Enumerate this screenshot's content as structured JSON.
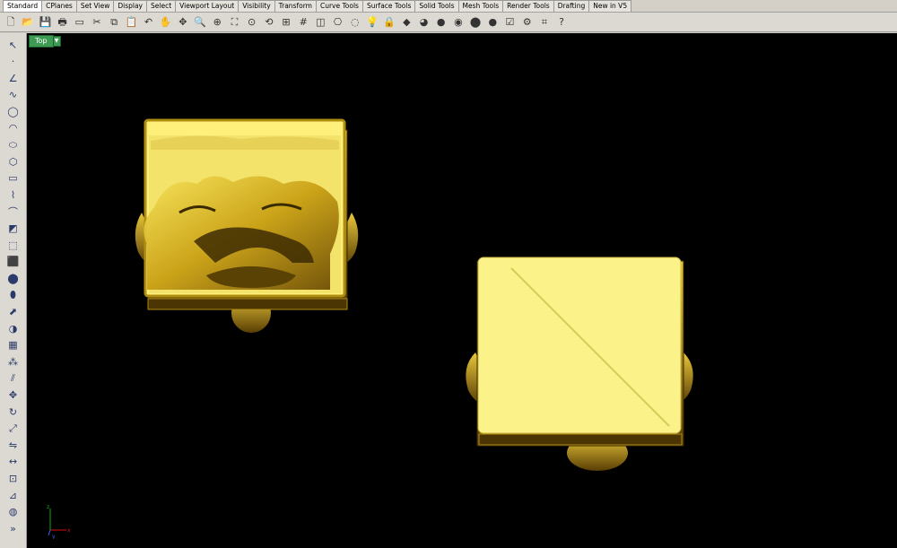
{
  "tabs": [
    "Standard",
    "CPlanes",
    "Set View",
    "Display",
    "Select",
    "Viewport Layout",
    "Visibility",
    "Transform",
    "Curve Tools",
    "Surface Tools",
    "Solid Tools",
    "Mesh Tools",
    "Render Tools",
    "Drafting",
    "New in V5"
  ],
  "toolbar_icons": [
    "new-file-icon",
    "open-icon",
    "save-icon",
    "print-icon",
    "import-icon",
    "cut-icon",
    "copy-icon",
    "paste-icon",
    "undo-icon",
    "pan-icon",
    "move-view-icon",
    "zoom-icon",
    "zoom-window-icon",
    "zoom-extents-icon",
    "zoom-selected-icon",
    "rotate-view-icon",
    "viewport-layout-icon",
    "grid-icon",
    "cplane-icon",
    "select-curves-icon",
    "hide-icon",
    "light-bulb-icon",
    "lock-icon",
    "layer-icon",
    "color-wheel-icon",
    "material-icon",
    "render-sphere-icon",
    "shaded-sphere-icon",
    "rendered-sphere-icon",
    "options-icon",
    "gear-icon",
    "snapshot-icon",
    "help-icon"
  ],
  "sidebar_icons": [
    "select-arrow-icon",
    "point-icon",
    "polyline-icon",
    "curve-icon",
    "circle-icon",
    "arc-icon",
    "ellipse-icon",
    "polygon-icon",
    "rectangle-icon",
    "free-form-icon",
    "fillet-icon",
    "surface-corner-icon",
    "surface-curve-icon",
    "box-solid-icon",
    "sphere-solid-icon",
    "cylinder-icon",
    "extrude-icon",
    "boolean-icon",
    "mesh-icon",
    "array-icon",
    "split-icon",
    "move-icon",
    "rotate-icon",
    "scale-icon",
    "mirror-icon",
    "dimension-icon",
    "group-icon",
    "analyze-icon",
    "render-icon",
    "more-icon"
  ],
  "viewport": {
    "name": "Top"
  },
  "axis": {
    "x_label": "x",
    "y_label": "y",
    "z_label": "z"
  }
}
